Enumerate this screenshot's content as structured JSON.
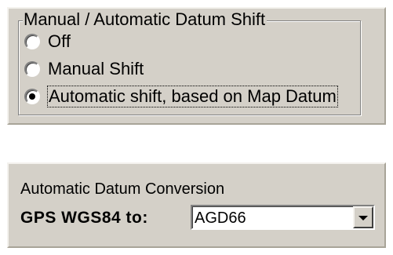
{
  "datum_shift": {
    "group_title": "Manual / Automatic Datum Shift",
    "options": [
      {
        "label": "Off",
        "checked": false
      },
      {
        "label": "Manual Shift",
        "checked": false
      },
      {
        "label": "Automatic shift, based on Map Datum",
        "checked": true
      }
    ]
  },
  "conversion": {
    "title": "Automatic Datum Conversion",
    "gps_label": "GPS WGS84 to:",
    "selected_datum": "AGD66"
  },
  "icons": {
    "combo_button": "chevron-down-icon"
  },
  "colors": {
    "panel_background": "#d4d0c8",
    "page_background": "#ffffff"
  }
}
